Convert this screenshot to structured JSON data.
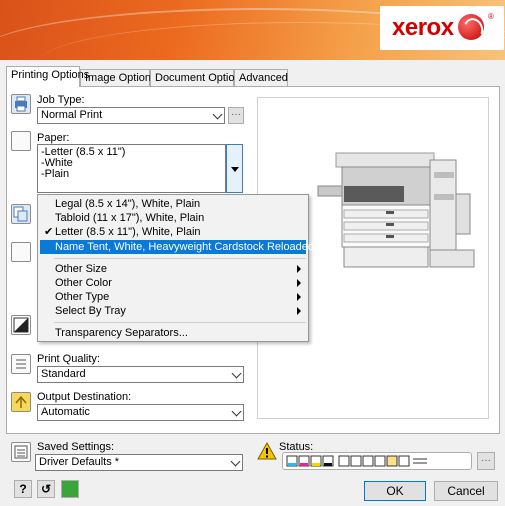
{
  "brand": {
    "logo_text": "xerox",
    "registered": "®",
    "accent": "#d40000",
    "banner_orange": "#ec6a1f"
  },
  "tabs": [
    {
      "label": "Printing Options",
      "active": true
    },
    {
      "label": "Image Options",
      "active": false
    },
    {
      "label": "Document Options",
      "active": false
    },
    {
      "label": "Advanced",
      "active": false
    }
  ],
  "job_type": {
    "label": "Job Type:",
    "value": "Normal Print",
    "more": "···",
    "icon": "printer-icon"
  },
  "paper": {
    "label": "Paper:",
    "lines": [
      "-Letter (8.5 x 11\")",
      "-White",
      "-Plain"
    ],
    "icon": "paper-icon"
  },
  "paper_menu": {
    "items": [
      {
        "label": "Legal (8.5 x 14\"), White, Plain",
        "checked": false,
        "selected": false
      },
      {
        "label": "Tabloid (11 x 17\"), White, Plain",
        "checked": false,
        "selected": false
      },
      {
        "label": "Letter (8.5 x 11\"), White, Plain",
        "checked": true,
        "selected": false
      },
      {
        "label": "Name Tent, White, Heavyweight Cardstock Reloaded",
        "checked": false,
        "selected": true
      }
    ],
    "sub_items": [
      "Other Size",
      "Other Color",
      "Other Type",
      "Select By Tray"
    ],
    "last_item": "Transparency Separators...",
    "check_glyph": "✔"
  },
  "print_quality": {
    "label": "Print Quality:",
    "value": "Standard",
    "icon": "quality-icon"
  },
  "output_destination": {
    "label": "Output Destination:",
    "value": "Automatic",
    "icon": "output-icon"
  },
  "saved_settings": {
    "label": "Saved Settings:",
    "value": "Driver Defaults *",
    "icon": "saved-settings-icon"
  },
  "status": {
    "label": "Status:",
    "icon": "warning-icon",
    "more": "···",
    "warning_color": "#f5c400"
  },
  "buttons": {
    "help": "?",
    "reset": "↺",
    "ok": "OK",
    "cancel": "Cancel"
  }
}
